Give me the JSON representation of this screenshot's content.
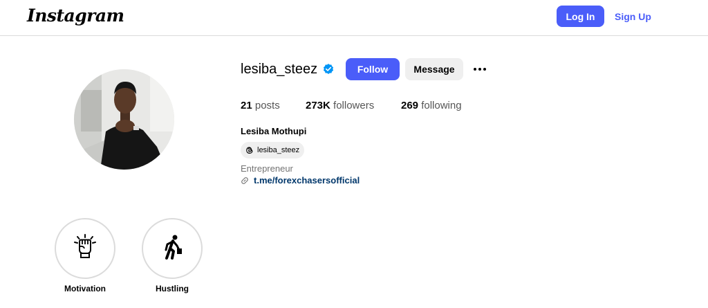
{
  "header": {
    "logo_text": "Instagram",
    "login_label": "Log In",
    "signup_label": "Sign Up",
    "accent_color": "#4a5df9"
  },
  "profile": {
    "username": "lesiba_steez",
    "verified": true,
    "follow_label": "Follow",
    "message_label": "Message",
    "more_icon": "more-horizontal-icon",
    "stats": {
      "posts_count": "21",
      "posts_label": "posts",
      "followers_count": "273K",
      "followers_label": "followers",
      "following_count": "269",
      "following_label": "following"
    },
    "full_name": "Lesiba Mothupi",
    "threads_handle": "lesiba_steez",
    "category": "Entrepreneur",
    "link": "t.me/forexchasersofficial",
    "link_color": "#00376b"
  },
  "highlights": [
    {
      "label": "Motivation",
      "icon": "raised-fist-icon"
    },
    {
      "label": "Hustling",
      "icon": "running-figure-icon"
    }
  ]
}
